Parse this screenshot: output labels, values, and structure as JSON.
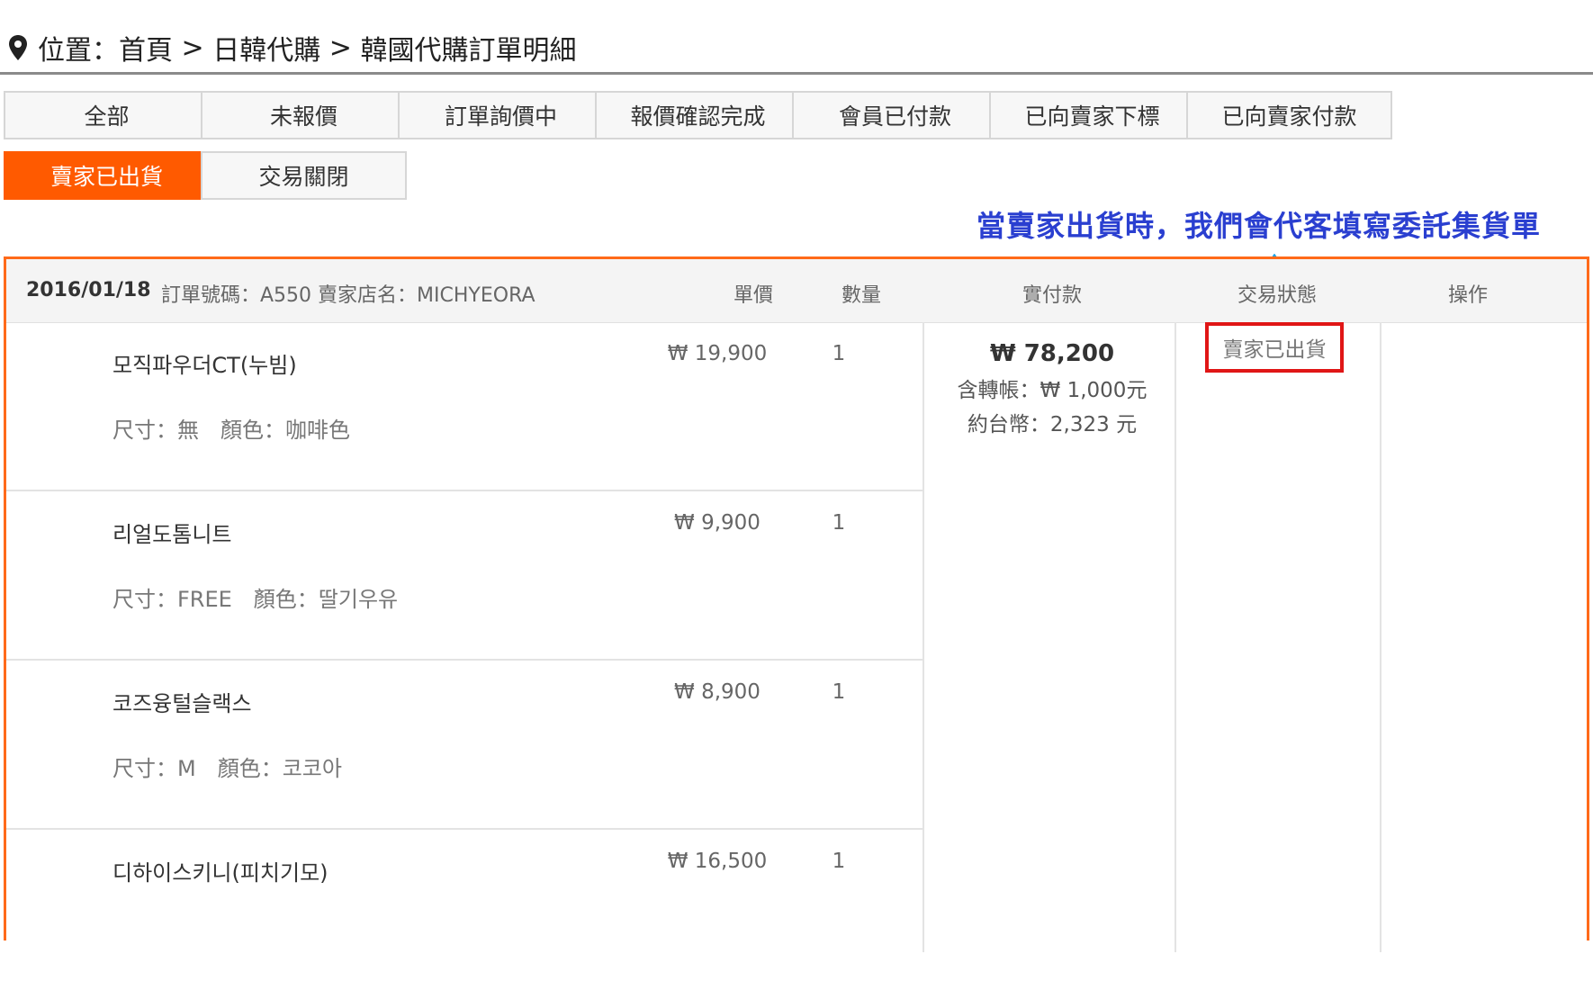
{
  "breadcrumb": {
    "prefix": "位置：",
    "items": [
      "首頁",
      "日韓代購",
      "韓國代購訂單明細"
    ],
    "separator": ">"
  },
  "tabs": [
    {
      "label": "全部",
      "active": false
    },
    {
      "label": "未報價",
      "active": false
    },
    {
      "label": "訂單詢價中",
      "active": false
    },
    {
      "label": "報價確認完成",
      "active": false
    },
    {
      "label": "會員已付款",
      "active": false
    },
    {
      "label": "已向賣家下標",
      "active": false
    },
    {
      "label": "已向賣家付款",
      "active": false
    },
    {
      "label": "賣家已出貨",
      "active": true
    },
    {
      "label": "交易關閉",
      "active": false
    }
  ],
  "annotation": "當賣家出貨時，我們會代客填寫委託集貨單",
  "order": {
    "date": "2016/01/18",
    "meta": "訂單號碼：A550 賣家店名：MICHYEORA",
    "columns": {
      "price": "單價",
      "qty": "數量",
      "paid": "實付款",
      "status": "交易狀態",
      "action": "操作"
    },
    "items": [
      {
        "name": "모직파우더CT(누빔)",
        "spec": "尺寸：無　顏色：咖啡色",
        "price": "₩ 19,900",
        "qty": "1"
      },
      {
        "name": "리얼도톰니트",
        "spec": "尺寸：FREE　顏色：딸기우유",
        "price": "₩ 9,900",
        "qty": "1"
      },
      {
        "name": "코즈융털슬랙스",
        "spec": "尺寸：M　顏色：코코아",
        "price": "₩ 8,900",
        "qty": "1"
      },
      {
        "name": "디하이스키니(피치기모)",
        "spec": "",
        "price": "₩ 16,500",
        "qty": "1"
      }
    ],
    "paid": {
      "total": "₩ 78,200",
      "transfer": "含轉帳：₩ 1,000元",
      "twd": "約台幣：2,323 元"
    },
    "status": "賣家已出貨"
  },
  "colors": {
    "accent": "#ff5a00",
    "border": "#ff6a1a",
    "status_box": "#e01616",
    "annotation": "#2a3fd0"
  }
}
